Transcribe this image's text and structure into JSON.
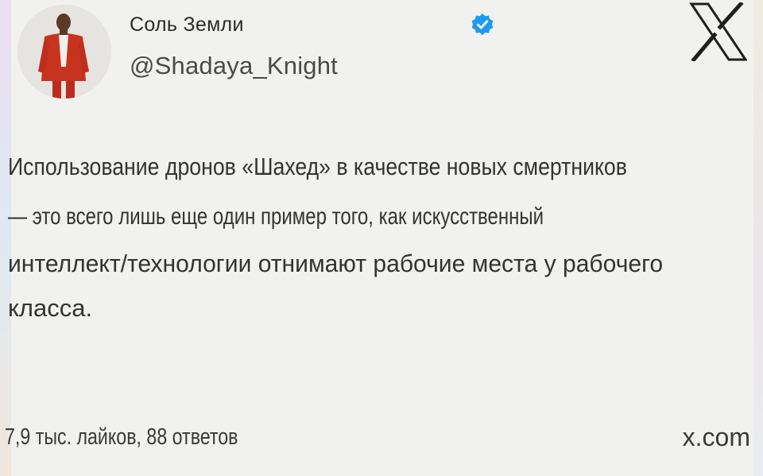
{
  "author": {
    "display_name": "Соль Земли",
    "handle": "@Shadaya_Knight",
    "verified": true,
    "avatar_icon": "avatar-photo-man-red-suit"
  },
  "platform_logo": "x-logo-icon",
  "tweet": {
    "lines": [
      "Использование дронов «Шахед» в качестве новых смертников",
      "— это всего лишь еще один пример того, как искусственный",
      "интеллект/технологии отнимают рабочие места у рабочего",
      "класса."
    ]
  },
  "footer": {
    "stats": "7,9 тыс. лайков, 88 ответов",
    "source": "x.com"
  },
  "colors": {
    "background": "#f1f1f0",
    "text": "#333333",
    "verified_badge": "#1d9bf0",
    "suit": "#c8331f"
  }
}
